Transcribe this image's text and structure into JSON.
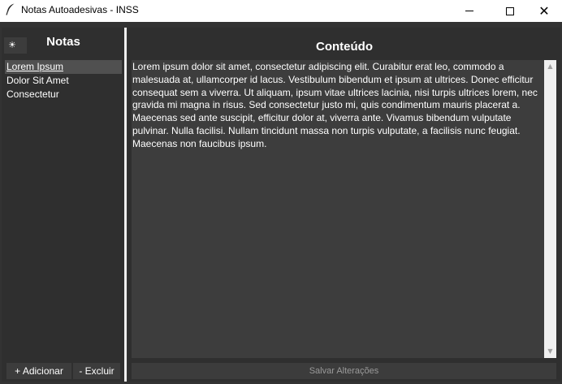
{
  "window": {
    "title": "Notas Autoadesivas - INSS",
    "app_icon": "feather-icon",
    "controls": {
      "minimize": "minimize-icon",
      "maximize": "maximize-icon",
      "close_glyph": "✕"
    }
  },
  "sidebar": {
    "theme_toggle_glyph": "☀",
    "title": "Notas",
    "items": [
      {
        "label": "Lorem Ipsum",
        "selected": true
      },
      {
        "label": "Dolor Sit Amet",
        "selected": false
      },
      {
        "label": "Consectetur",
        "selected": false
      }
    ],
    "add_label": "+ Adicionar",
    "delete_label": "- Excluir"
  },
  "main": {
    "title": "Conteúdo",
    "content": "Lorem ipsum dolor sit amet, consectetur adipiscing elit. Curabitur erat leo, commodo a malesuada at, ullamcorper id lacus. Vestibulum bibendum et ipsum at ultrices. Donec efficitur consequat sem a viverra. Ut aliquam, ipsum vitae ultrices lacinia, nisi turpis ultrices lorem, nec gravida mi magna in risus. Sed consectetur justo mi, quis condimentum mauris placerat a. Maecenas sed ante suscipit, efficitur dolor at, viverra ante. Vivamus bibendum vulputate pulvinar. Nulla facilisi. Nullam tincidunt massa non turpis vulputate, a facilisis nunc feugiat. Maecenas non faucibus ipsum.",
    "save_label": "Salvar Alterações",
    "scroll_up_glyph": "▲",
    "scroll_down_glyph": "▼"
  },
  "colors": {
    "background": "#333333",
    "panel": "#2f2f2f",
    "text_area": "#3d3d3d",
    "selected_item": "#505050",
    "text": "#ffffff"
  }
}
